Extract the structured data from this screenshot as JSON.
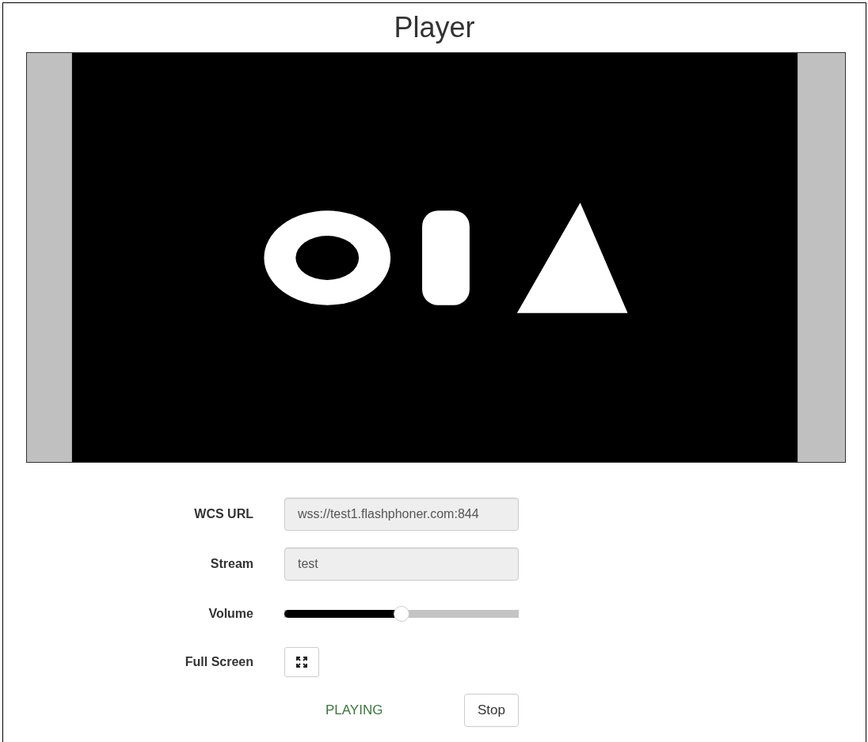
{
  "title": "Player",
  "fields": [
    {
      "label": "WCS URL",
      "value": "wss://test1.flashphoner.com:844",
      "disabled": true
    },
    {
      "label": "Stream",
      "value": "test",
      "disabled": true
    }
  ],
  "volume": {
    "label": "Volume",
    "level": 0.5
  },
  "fullscreen": {
    "label": "Full Screen"
  },
  "status": "PLAYING",
  "stop_button": "Stop"
}
